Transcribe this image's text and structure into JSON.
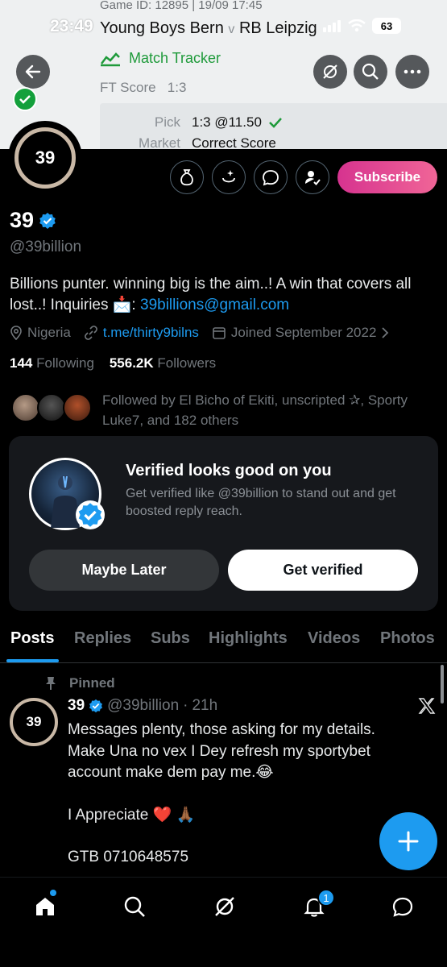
{
  "status_bar": {
    "time": "23:49",
    "battery": "63"
  },
  "banner": {
    "game_id": "Game ID: 12895 | 19/09 17:45",
    "home": "Young Boys Bern",
    "vs": "v",
    "away": "RB Leipzig",
    "tracker": "Match Tracker",
    "ft_label": "FT Score",
    "ft_value": "1:3",
    "pick_label": "Pick",
    "pick_value": "1:3 @11.50",
    "market_label": "Market",
    "market_value": "Correct Score"
  },
  "profile": {
    "avatar_text": "39",
    "name": "39",
    "handle": "@39billion",
    "bio_text": "Billions punter. winning big is the aim..! A win that covers all lost..! Inquiries 📩: ",
    "bio_email": "39billions@gmail.com",
    "location": "Nigeria",
    "website": "t.me/thirty9bilns",
    "joined": "Joined September 2022",
    "following_count": "144",
    "following_label": "Following",
    "followers_count": "556.2K",
    "followers_label": "Followers",
    "followed_by": "Followed by El Bicho of Ekiti, unscripted ✰, Sporty Luke7, and 182 others",
    "subscribe_label": "Subscribe"
  },
  "verify_card": {
    "title": "Verified looks good on you",
    "subtitle": "Get verified like @39billion to stand out and get boosted reply reach.",
    "later_label": "Maybe Later",
    "verify_label": "Get verified"
  },
  "tabs": [
    "Posts",
    "Replies",
    "Subs",
    "Highlights",
    "Videos",
    "Photos"
  ],
  "tweet": {
    "pinned_label": "Pinned",
    "avatar_text": "39",
    "name": "39",
    "handle": "@39billion",
    "sep": "·",
    "time": "21h",
    "line1": "Messages plenty, those asking for my details. Make Una no vex I Dey refresh my sportybet account make dem pay me.😂",
    "line2": "I Appreciate ❤️ 🙏🏾",
    "line3": "GTB 0710648575"
  },
  "nav": {
    "notifications_badge": "1"
  },
  "colors": {
    "accent": "#1d9bf0",
    "subscribe": "#e0418f",
    "tracker_green": "#1e9a3a"
  }
}
